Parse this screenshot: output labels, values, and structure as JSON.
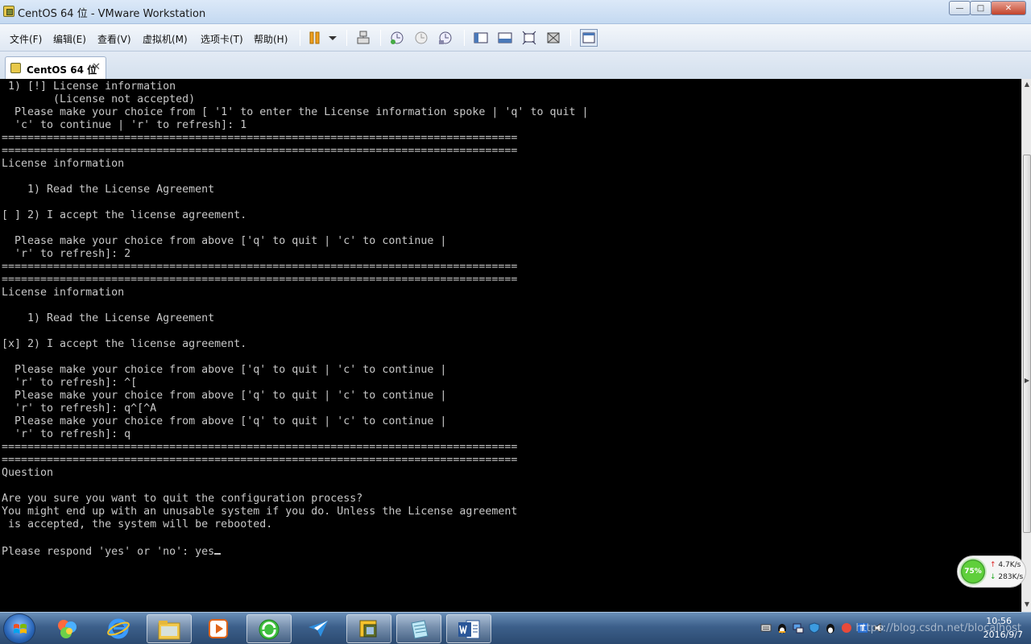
{
  "window": {
    "title": "CentOS 64 位 - VMware Workstation",
    "buttons": {
      "minimize": "—",
      "maximize": "□",
      "close": "✕"
    }
  },
  "menu": {
    "file": "文件(F)",
    "edit": "编辑(E)",
    "view": "查看(V)",
    "vm": "虚拟机(M)",
    "tabs": "选项卡(T)",
    "help": "帮助(H)"
  },
  "tab": {
    "label": "CentOS 64 位",
    "close": "✕"
  },
  "terminal": {
    "lines": [
      " 1) [!] License information",
      "        (License not accepted)",
      "  Please make your choice from [ '1' to enter the License information spoke | 'q' to quit |",
      "  'c' to continue | 'r' to refresh]: 1",
      "================================================================================",
      "================================================================================",
      "License information",
      "",
      "    1) Read the License Agreement",
      "",
      "[ ] 2) I accept the license agreement.",
      "",
      "  Please make your choice from above ['q' to quit | 'c' to continue |",
      "  'r' to refresh]: 2",
      "================================================================================",
      "================================================================================",
      "License information",
      "",
      "    1) Read the License Agreement",
      "",
      "[x] 2) I accept the license agreement.",
      "",
      "  Please make your choice from above ['q' to quit | 'c' to continue |",
      "  'r' to refresh]: ^[",
      "  Please make your choice from above ['q' to quit | 'c' to continue |",
      "  'r' to refresh]: q^[^A",
      "  Please make your choice from above ['q' to quit | 'c' to continue |",
      "  'r' to refresh]: q",
      "================================================================================",
      "================================================================================",
      "Question",
      "",
      "Are you sure you want to quit the configuration process?",
      "You might end up with an unusable system if you do. Unless the License agreement",
      " is accepted, the system will be rebooted.",
      "",
      "Please respond 'yes' or 'no': yes"
    ]
  },
  "net_monitor": {
    "percent": "75%",
    "upload": "4.7K/s",
    "download": "283K/s"
  },
  "taskbar": {
    "watermark": "https://blog.csdn.net/blocalhost",
    "time": "10:56",
    "date": "2016/9/7"
  },
  "colors": {
    "terminal_bg": "#000000",
    "terminal_fg": "#c8c8c8",
    "titlebar": "#c4d9f1",
    "taskbar": "#3c5f8a"
  }
}
